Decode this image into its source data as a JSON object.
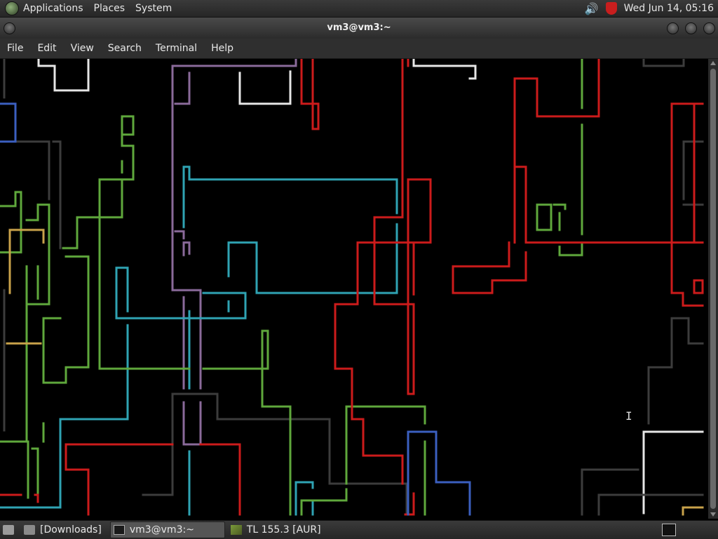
{
  "top_panel": {
    "menus": [
      "Applications",
      "Places",
      "System"
    ],
    "clock": "Wed Jun 14, 05:16",
    "icons": [
      "distro-logo-icon",
      "speaker-icon",
      "security-shield-icon"
    ]
  },
  "window": {
    "title": "vm3@vm3:~"
  },
  "terminal_menu": [
    "File",
    "Edit",
    "View",
    "Search",
    "Terminal",
    "Help"
  ],
  "terminal": {
    "program": "pipes screensaver",
    "colors": {
      "red": "#cc1b1b",
      "green": "#5fa83c",
      "cyan": "#2fa3b3",
      "purple": "#8a6a9a",
      "white": "#e6e6e6",
      "gray": "#3c3c3c",
      "blue": "#3b5fbf",
      "yellow": "#c9a24a"
    }
  },
  "taskbar": {
    "tasks": [
      {
        "label": "[Downloads]",
        "icon": "folder-icon",
        "active": false
      },
      {
        "label": "vm3@vm3:~",
        "icon": "terminal-icon",
        "active": true
      },
      {
        "label": "TL 155.3 [AUR]",
        "icon": "package-icon",
        "active": false
      }
    ]
  }
}
